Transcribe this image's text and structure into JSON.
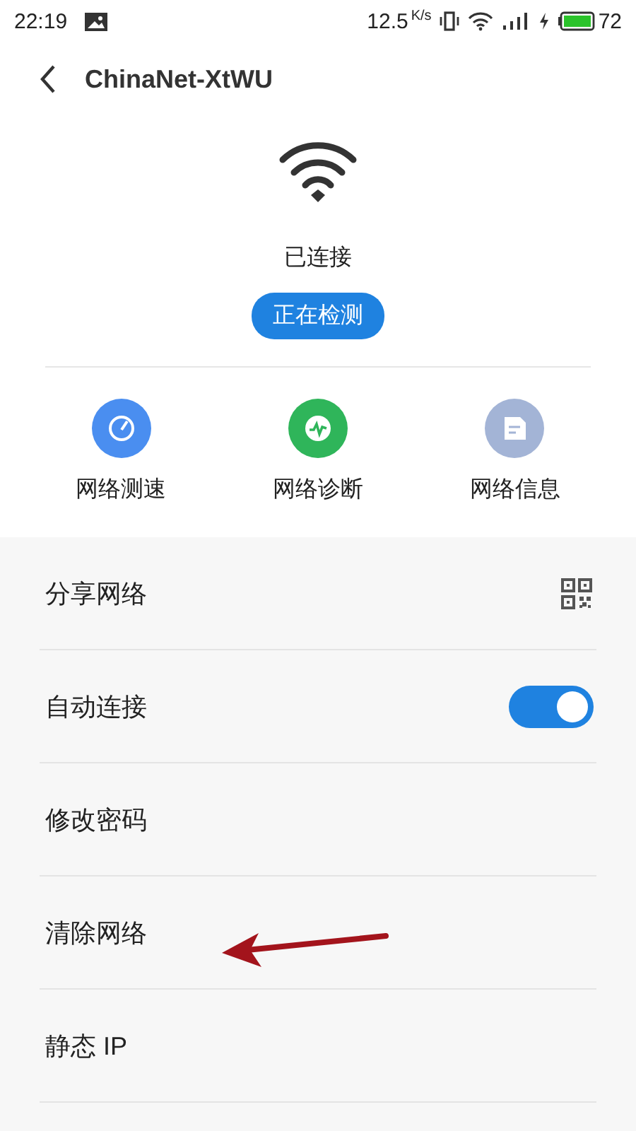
{
  "status_bar": {
    "time": "22:19",
    "speed": "12.5",
    "speed_unit": "K/s",
    "battery": "72"
  },
  "header": {
    "title": "ChinaNet-XtWU"
  },
  "connection": {
    "status": "已连接",
    "button": "正在检测"
  },
  "actions": [
    {
      "label": "网络测速",
      "kind": "speed",
      "color": "#4a8ef0"
    },
    {
      "label": "网络诊断",
      "kind": "diagnose",
      "color": "#2fb55a"
    },
    {
      "label": "网络信息",
      "kind": "info",
      "color": "#a3b4d6"
    }
  ],
  "settings": [
    {
      "label": "分享网络",
      "kind": "qr"
    },
    {
      "label": "自动连接",
      "kind": "toggle",
      "on": true
    },
    {
      "label": "修改密码",
      "kind": "plain"
    },
    {
      "label": "清除网络",
      "kind": "plain"
    },
    {
      "label": "静态 IP",
      "kind": "plain"
    }
  ]
}
